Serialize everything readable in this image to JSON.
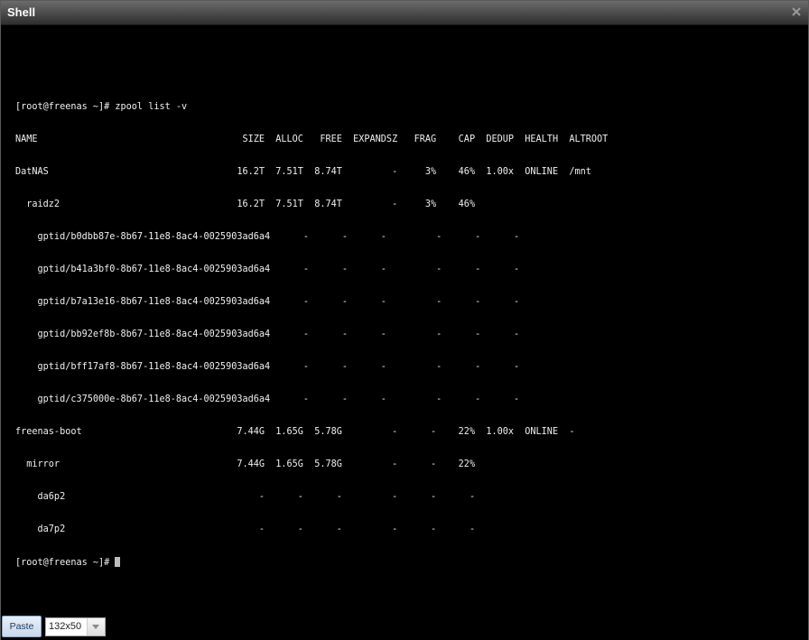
{
  "window": {
    "title": "Shell"
  },
  "terminal": {
    "lines": [
      "",
      "[root@freenas ~]# zpool list -v",
      "NAME                                     SIZE  ALLOC   FREE  EXPANDSZ   FRAG    CAP  DEDUP  HEALTH  ALTROOT",
      "DatNAS                                  16.2T  7.51T  8.74T         -     3%    46%  1.00x  ONLINE  /mnt",
      "  raidz2                                16.2T  7.51T  8.74T         -     3%    46%",
      "    gptid/b0dbb87e-8b67-11e8-8ac4-0025903ad6a4      -      -      -         -      -      -",
      "    gptid/b41a3bf0-8b67-11e8-8ac4-0025903ad6a4      -      -      -         -      -      -",
      "    gptid/b7a13e16-8b67-11e8-8ac4-0025903ad6a4      -      -      -         -      -      -",
      "    gptid/bb92ef8b-8b67-11e8-8ac4-0025903ad6a4      -      -      -         -      -      -",
      "    gptid/bff17af8-8b67-11e8-8ac4-0025903ad6a4      -      -      -         -      -      -",
      "    gptid/c375000e-8b67-11e8-8ac4-0025903ad6a4      -      -      -         -      -      -",
      "freenas-boot                            7.44G  1.65G  5.78G         -      -    22%  1.00x  ONLINE  -",
      "  mirror                                7.44G  1.65G  5.78G         -      -    22%",
      "    da6p2                                   -      -      -         -      -      -",
      "    da7p2                                   -      -      -         -      -      -"
    ],
    "prompt": "[root@freenas ~]# "
  },
  "bottom_bar": {
    "paste_label": "Paste",
    "size_value": "132x50"
  }
}
